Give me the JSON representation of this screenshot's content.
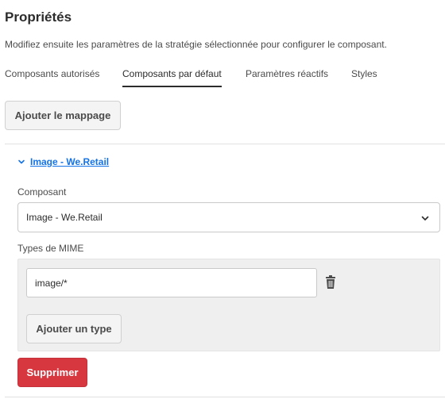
{
  "header": {
    "title": "Propriétés",
    "description": "Modifiez ensuite les paramètres de la stratégie sélectionnée pour configurer le composant."
  },
  "tabs": [
    {
      "label": "Composants autorisés",
      "active": false
    },
    {
      "label": "Composants par défaut",
      "active": true
    },
    {
      "label": "Paramètres réactifs",
      "active": false
    },
    {
      "label": "Styles",
      "active": false
    }
  ],
  "add_mapping_label": "Ajouter le mappage",
  "mapping": {
    "accordion_label": "Image - We.Retail",
    "component_label": "Composant",
    "component_value": "Image - We.Retail",
    "mime_label": "Types de MIME",
    "mime_values": [
      "image/*"
    ],
    "add_type_label": "Ajouter un type",
    "delete_label": "Supprimer"
  },
  "colors": {
    "accent": "#1473e6",
    "danger": "#d7373f",
    "panel_bg": "#efefef"
  },
  "icons": {
    "accordion": "chevron-down-icon",
    "select": "chevron-down-icon",
    "remove": "trash-icon"
  }
}
